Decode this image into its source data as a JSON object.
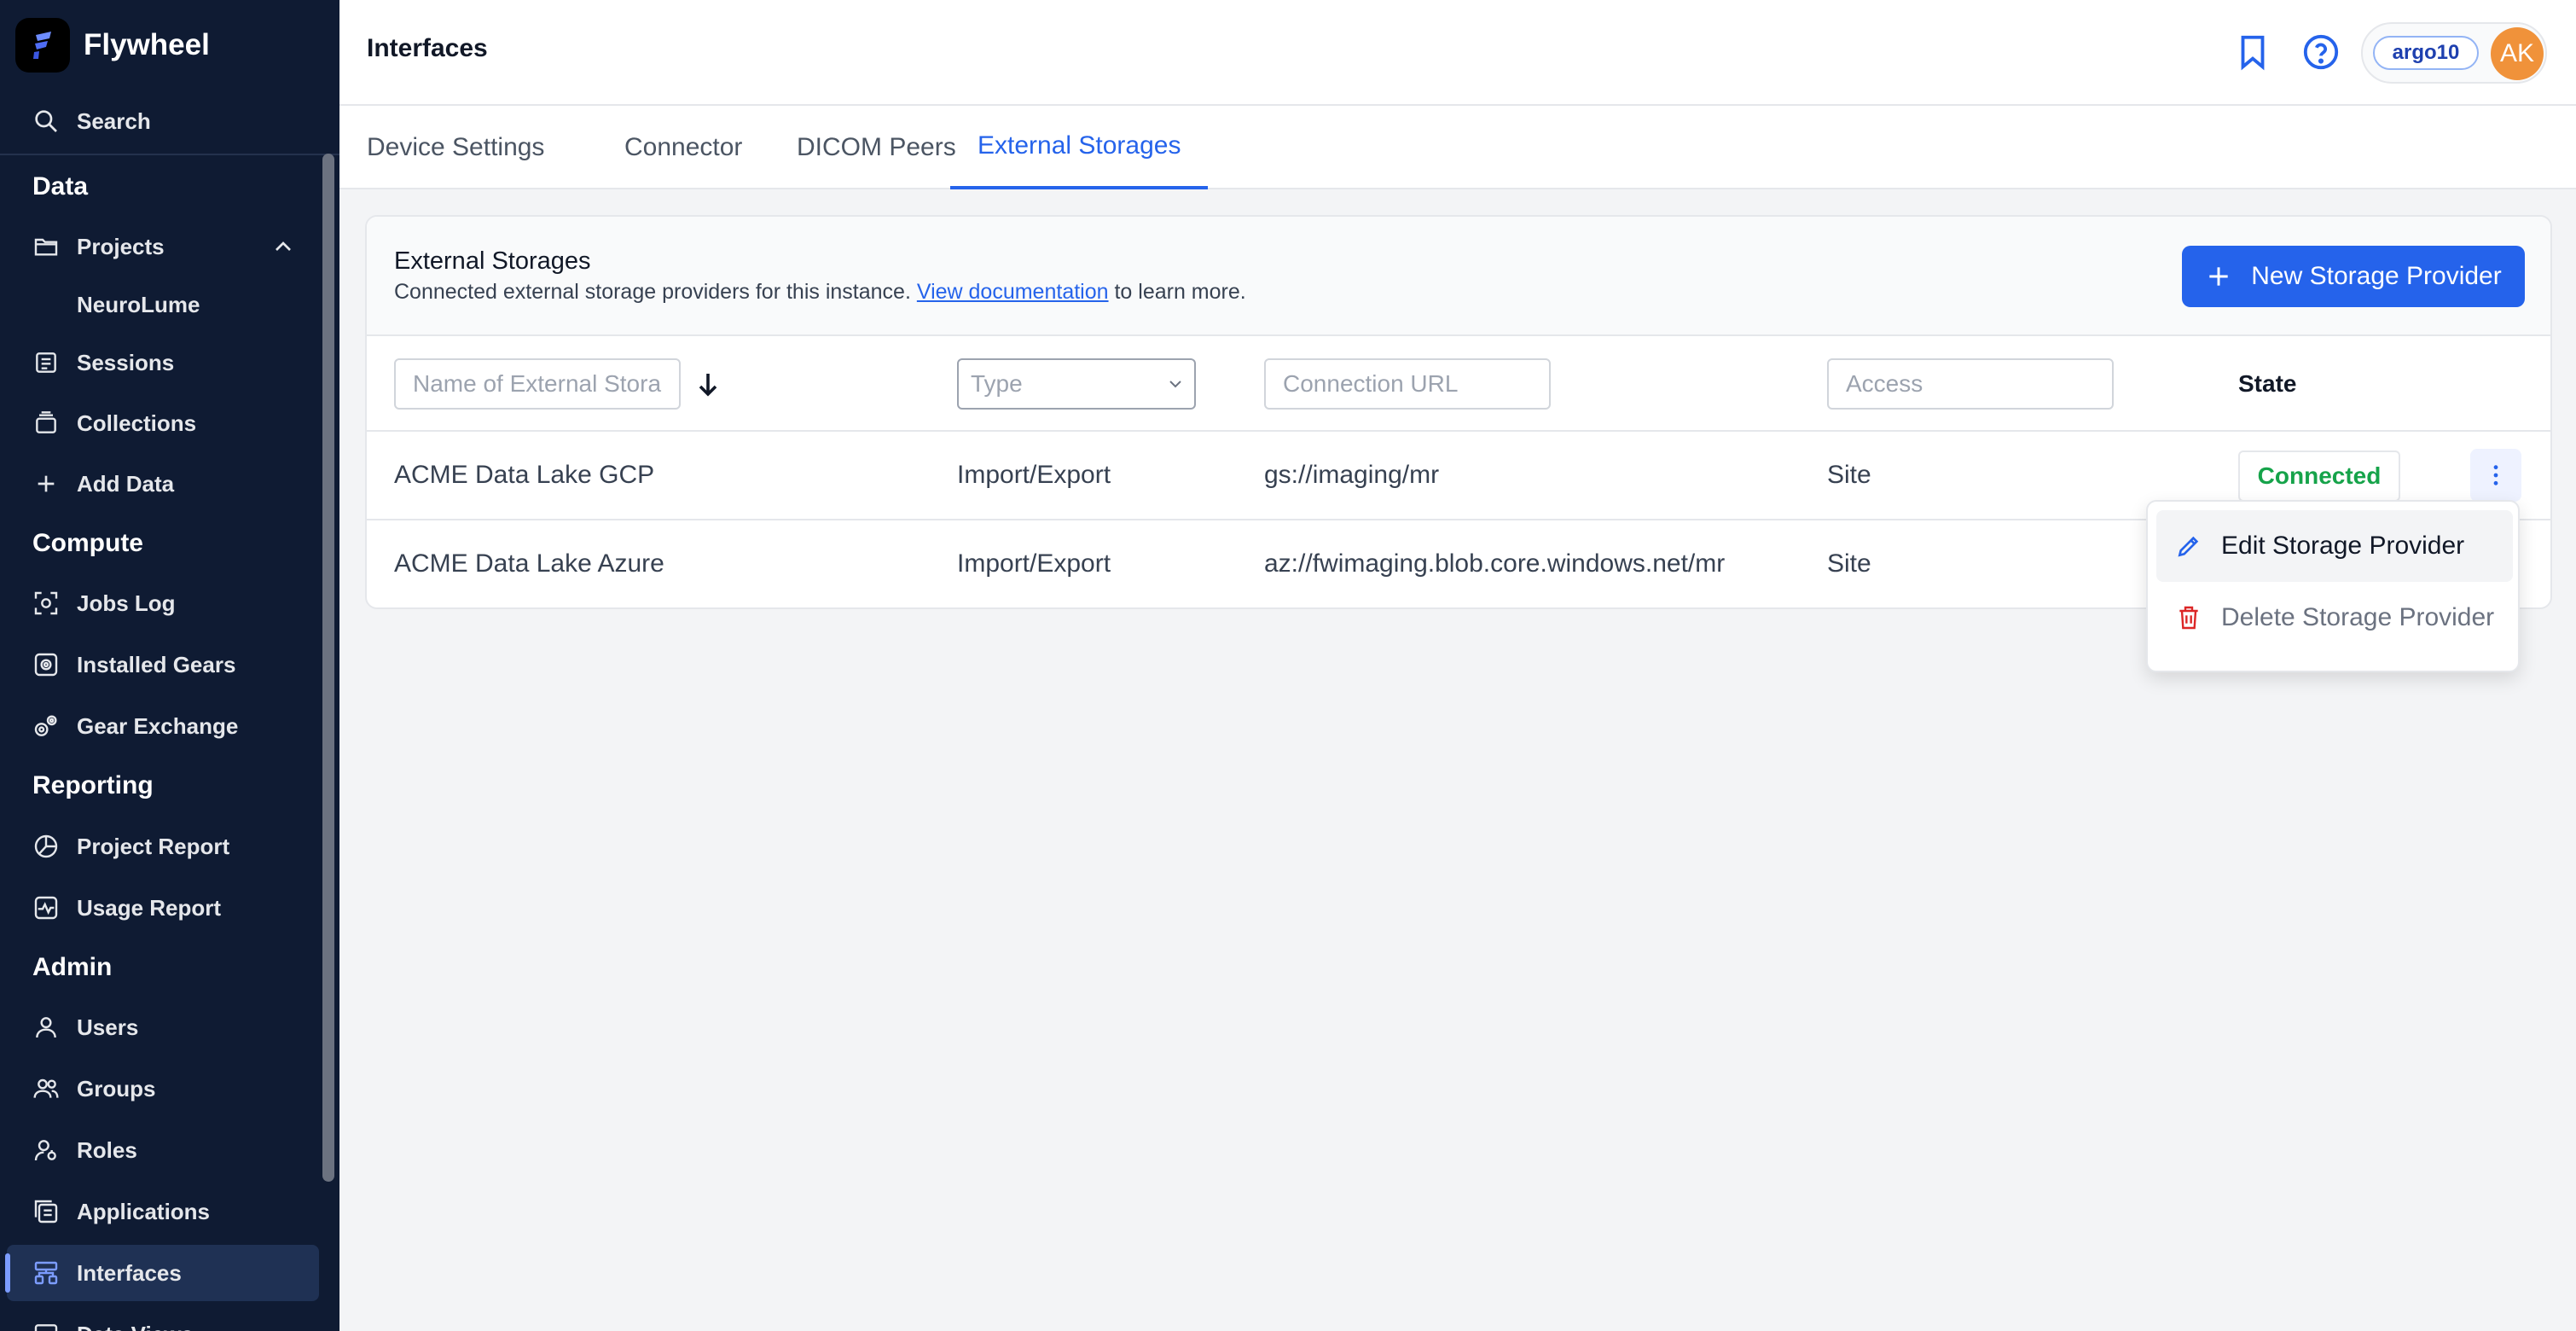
{
  "app": {
    "name": "Flywheel"
  },
  "sidebar": {
    "search": "Search",
    "sections": {
      "data": "Data",
      "compute": "Compute",
      "reporting": "Reporting",
      "admin": "Admin"
    },
    "items": {
      "projects": "Projects",
      "neurolume": "NeuroLume",
      "sessions": "Sessions",
      "collections": "Collections",
      "add_data": "Add Data",
      "jobs_log": "Jobs Log",
      "installed_gears": "Installed Gears",
      "gear_exchange": "Gear Exchange",
      "project_report": "Project Report",
      "usage_report": "Usage Report",
      "users": "Users",
      "groups": "Groups",
      "roles": "Roles",
      "applications": "Applications",
      "interfaces": "Interfaces",
      "data_views": "Data Views"
    }
  },
  "header": {
    "title": "Interfaces",
    "org": "argo10",
    "avatar_initials": "AK",
    "avatar_color": "#f0923a"
  },
  "tabs": {
    "device_settings": "Device Settings",
    "connector": "Connector",
    "dicom_peers": "DICOM Peers",
    "external_storages": "External Storages"
  },
  "card": {
    "title": "External Storages",
    "description_before": "Connected external storage providers for this instance. ",
    "doc_link": "View documentation",
    "description_after": " to learn more.",
    "new_button": "New Storage Provider",
    "accent_color": "#2563eb"
  },
  "table": {
    "filters": {
      "name_placeholder": "Name of External Storage",
      "type_placeholder": "Type",
      "url_placeholder": "Connection URL",
      "access_placeholder": "Access"
    },
    "state_header": "State",
    "rows": [
      {
        "name": "ACME Data Lake GCP",
        "type": "Import/Export",
        "url": "gs://imaging/mr",
        "access": "Site",
        "state": "Connected"
      },
      {
        "name": "ACME Data Lake Azure",
        "type": "Import/Export",
        "url": "az://fwimaging.blob.core.windows.net/mr",
        "access": "Site",
        "state": ""
      }
    ]
  },
  "menu": {
    "edit": "Edit Storage Provider",
    "delete": "Delete Storage Provider"
  },
  "icons": [
    "search-icon",
    "folder-icon",
    "chevron-up-icon",
    "sessions-icon",
    "collections-icon",
    "plus-icon",
    "jobs-icon",
    "gears-icon",
    "gear-exchange-icon",
    "report-icon",
    "usage-icon",
    "user-icon",
    "users-icon",
    "role-icon",
    "applications-icon",
    "interfaces-icon",
    "bookmark-icon",
    "help-icon",
    "sort-down-icon",
    "chevron-down-icon",
    "kebab-icon",
    "pencil-icon",
    "trash-icon"
  ]
}
